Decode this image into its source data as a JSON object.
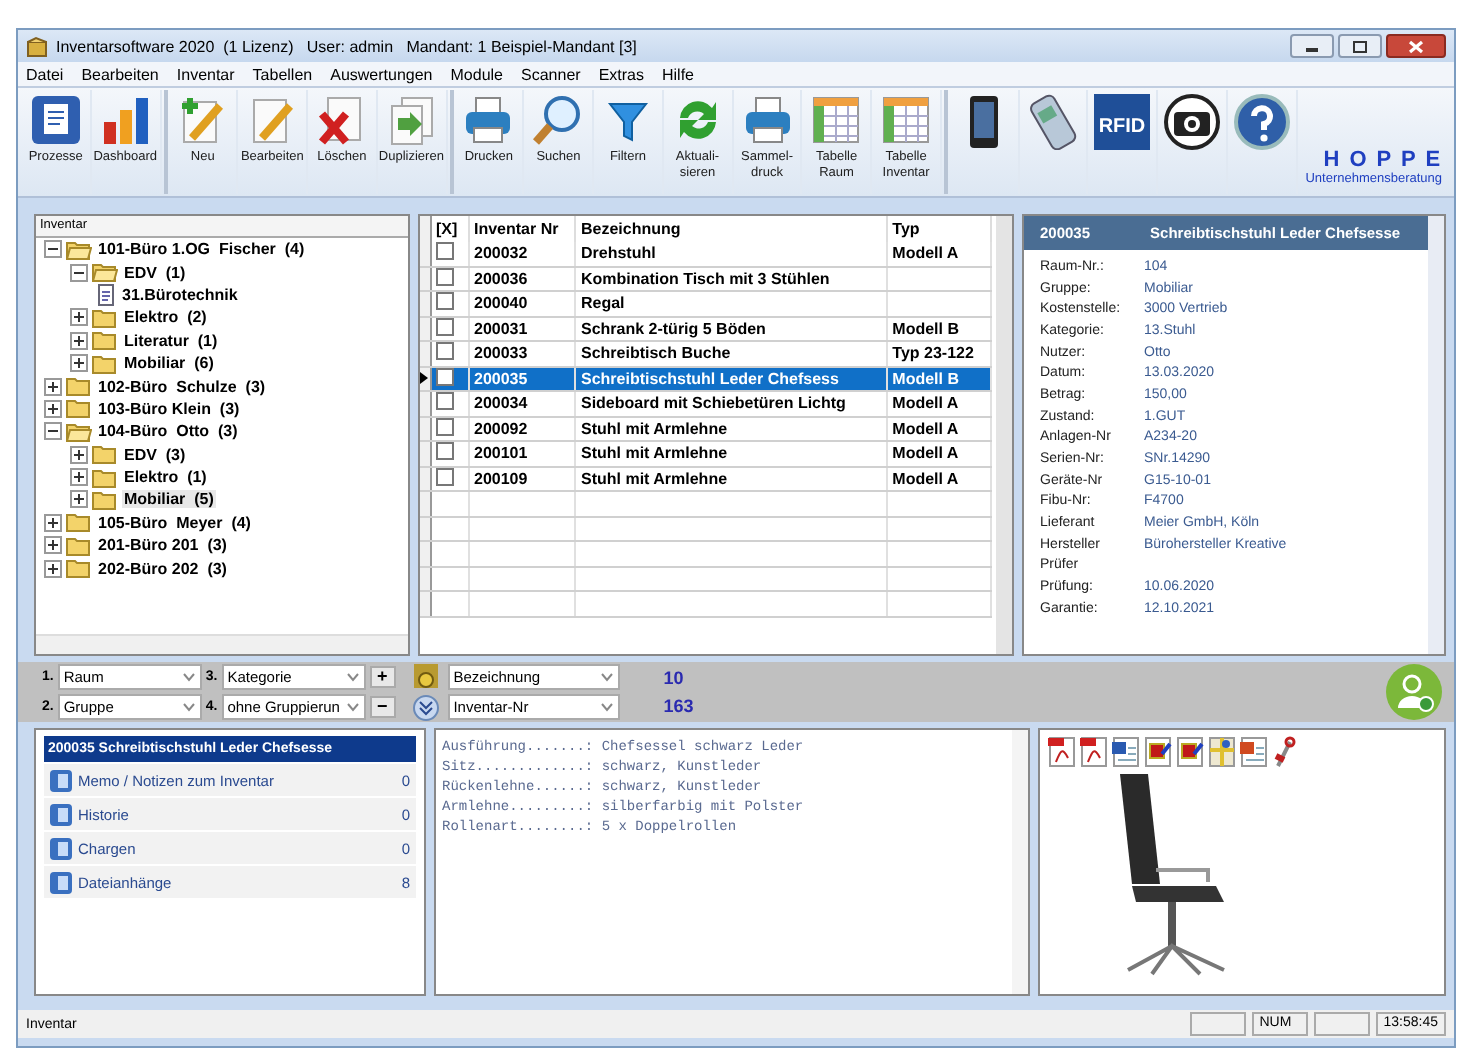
{
  "window": {
    "title": "Inventarsoftware 2020  (1 Lizenz)   User: admin   Mandant: 1 Beispiel-Mandant [3]"
  },
  "menu": [
    "Datei",
    "Bearbeiten",
    "Inventar",
    "Tabellen",
    "Auswertungen",
    "Module",
    "Scanner",
    "Extras",
    "Hilfe"
  ],
  "toolbar": [
    {
      "kind": "processes",
      "lines": [
        "Prozesse"
      ]
    },
    {
      "kind": "dashboard",
      "lines": [
        "Dashboard"
      ]
    },
    {
      "kind": "separator"
    },
    {
      "kind": "new",
      "lines": [
        "Neu"
      ]
    },
    {
      "kind": "edit",
      "lines": [
        "Bearbeiten"
      ]
    },
    {
      "kind": "delete",
      "lines": [
        "Löschen"
      ]
    },
    {
      "kind": "duplicate",
      "lines": [
        "Duplizieren"
      ]
    },
    {
      "kind": "separator"
    },
    {
      "kind": "print",
      "lines": [
        "Drucken"
      ]
    },
    {
      "kind": "search",
      "lines": [
        "Suchen"
      ]
    },
    {
      "kind": "filter",
      "lines": [
        "Filtern"
      ]
    },
    {
      "kind": "refresh",
      "lines": [
        "Aktuali-",
        "sieren"
      ]
    },
    {
      "kind": "print",
      "lines": [
        "Sammel-",
        "druck"
      ]
    },
    {
      "kind": "table",
      "lines": [
        "Tabelle",
        "Raum"
      ]
    },
    {
      "kind": "table",
      "lines": [
        "Tabelle",
        "Inventar"
      ]
    },
    {
      "kind": "separator"
    },
    {
      "kind": "phone"
    },
    {
      "kind": "scanner"
    },
    {
      "kind": "rfid",
      "text": "RFID"
    },
    {
      "kind": "camera"
    },
    {
      "kind": "help"
    }
  ],
  "logo": {
    "name": "H O P P E",
    "subtitle": "Unternehmensberatung"
  },
  "tree": {
    "header": "Inventar",
    "nodes": [
      {
        "kind": "folder",
        "label": "101-Büro 1.OG  Fischer  (4)",
        "expanded": true,
        "selected": false,
        "children": [
          {
            "kind": "folder",
            "label": "EDV  (1)",
            "expanded": true,
            "selected": false,
            "children": [
              {
                "kind": "document",
                "label": "31.Bürotechnik",
                "selected": false
              }
            ]
          },
          {
            "kind": "folder",
            "label": "Elektro  (2)",
            "expanded": false,
            "selected": false
          },
          {
            "kind": "folder",
            "label": "Literatur  (1)",
            "expanded": false,
            "selected": false
          },
          {
            "kind": "folder",
            "label": "Mobiliar  (6)",
            "expanded": false,
            "selected": false
          }
        ]
      },
      {
        "kind": "folder",
        "label": "102-Büro  Schulze  (3)",
        "expanded": false,
        "selected": false
      },
      {
        "kind": "folder",
        "label": "103-Büro Klein  (3)",
        "expanded": false,
        "selected": false
      },
      {
        "kind": "folder",
        "label": "104-Büro  Otto  (3)",
        "expanded": true,
        "selected": false,
        "children": [
          {
            "kind": "folder",
            "label": "EDV  (3)",
            "expanded": false,
            "selected": false
          },
          {
            "kind": "folder",
            "label": "Elektro  (1)",
            "expanded": false,
            "selected": false
          },
          {
            "kind": "folder",
            "label": "Mobiliar  (5)",
            "expanded": false,
            "selected": true
          }
        ]
      },
      {
        "kind": "folder",
        "label": "105-Büro  Meyer  (4)",
        "expanded": false,
        "selected": false
      },
      {
        "kind": "folder",
        "label": "201-Büro 201  (3)",
        "expanded": false,
        "selected": false
      },
      {
        "kind": "folder",
        "label": "202-Büro 202  (3)",
        "expanded": false,
        "selected": false
      }
    ]
  },
  "table": {
    "columns": [
      "[X]",
      "Inventar Nr",
      "Bezeichnung",
      "Typ"
    ],
    "rows": [
      {
        "checked": false,
        "selected": false,
        "nr": "200032",
        "name": "Drehstuhl",
        "type": "Modell A"
      },
      {
        "checked": false,
        "selected": false,
        "nr": "200036",
        "name": "Kombination Tisch mit 3 Stühlen"
      },
      {
        "checked": false,
        "selected": false,
        "nr": "200040",
        "name": "Regal"
      },
      {
        "checked": false,
        "selected": false,
        "nr": "200031",
        "name": "Schrank 2-türig 5 Böden",
        "type": "Modell B"
      },
      {
        "checked": false,
        "selected": false,
        "nr": "200033",
        "name": "Schreibtisch Buche",
        "type": "Typ 23-122"
      },
      {
        "checked": false,
        "selected": true,
        "nr": "200035",
        "name": "Schreibtischstuhl Leder Chefsess",
        "type": "Modell B"
      },
      {
        "checked": false,
        "selected": false,
        "nr": "200034",
        "name": "Sideboard mit Schiebetüren Lichtg",
        "type": "Modell A"
      },
      {
        "checked": false,
        "selected": false,
        "nr": "200092",
        "name": "Stuhl mit Armlehne",
        "type": "Modell A"
      },
      {
        "checked": false,
        "selected": false,
        "nr": "200101",
        "name": "Stuhl mit Armlehne",
        "type": "Modell A"
      },
      {
        "checked": false,
        "selected": false,
        "nr": "200109",
        "name": "Stuhl mit Armlehne",
        "type": "Modell A"
      }
    ]
  },
  "details": {
    "number": "200035",
    "title": "Schreibtischstuhl Leder Chefsesse",
    "fields": [
      {
        "label": "Raum-Nr.:",
        "value": "104"
      },
      {
        "label": "Gruppe:",
        "value": "Mobiliar"
      },
      {
        "label": "Kostenstelle:",
        "value": "3000 Vertrieb"
      },
      {
        "label": "Kategorie:",
        "value": "13.Stuhl"
      },
      {
        "label": "Nutzer:",
        "value": "Otto"
      },
      {
        "label": "Datum:",
        "value": "13.03.2020"
      },
      {
        "label": "Betrag:",
        "value": "150,00"
      },
      {
        "label": "Zustand:",
        "value": "1.GUT"
      },
      {
        "label": "Anlagen-Nr",
        "value": "A234-20"
      },
      {
        "label": "Serien-Nr:",
        "value": "SNr.14290"
      },
      {
        "label": "Geräte-Nr",
        "value": "G15-10-01"
      },
      {
        "label": "Fibu-Nr:",
        "value": "F4700"
      },
      {
        "label": "Lieferant",
        "value": "Meier GmbH, Köln"
      },
      {
        "label": "Hersteller",
        "value": "Bürohersteller Kreative"
      },
      {
        "label": "Prüfer"
      },
      {
        "label": "Prüfung:",
        "value": "10.06.2020"
      },
      {
        "label": "Garantie:",
        "value": "12.10.2021"
      }
    ]
  },
  "grouping": {
    "levels": [
      {
        "number": "1.",
        "value": "Raum"
      },
      {
        "number": "3.",
        "value": "Kategorie"
      },
      {
        "number": "2.",
        "value": "Gruppe"
      },
      {
        "number": "4.",
        "value": "ohne Gruppierun"
      }
    ],
    "add": "+",
    "remove": "−"
  },
  "sorting": {
    "fields": [
      "Bezeichnung",
      "Inventar-Nr"
    ],
    "counts": [
      "10",
      "163"
    ]
  },
  "item_panel": {
    "title": "200035 Schreibtischstuhl Leder Chefsesse",
    "items": [
      {
        "label": "Memo / Notizen zum Inventar",
        "count": "0"
      },
      {
        "label": "Historie",
        "count": "0"
      },
      {
        "label": "Chargen",
        "count": "0"
      },
      {
        "label": "Dateianhänge",
        "count": "8"
      }
    ]
  },
  "memo": [
    "Ausführung.......: Chefsessel schwarz Leder",
    "Sitz.............: schwarz, Kunstleder",
    "Rückenlehne......: schwarz, Kunstleder",
    "Armlehne.........: silberfarbig mit Polster",
    "Rollenart........: 5 x Doppelrollen"
  ],
  "attachments": [
    {
      "kind": "pdf"
    },
    {
      "kind": "pdf"
    },
    {
      "kind": "word"
    },
    {
      "kind": "image"
    },
    {
      "kind": "image"
    },
    {
      "kind": "map"
    },
    {
      "kind": "slides"
    },
    {
      "kind": "tools"
    }
  ],
  "status_bar": {
    "text": "Inventar",
    "indicator": "NUM",
    "time": "13:58:45"
  }
}
